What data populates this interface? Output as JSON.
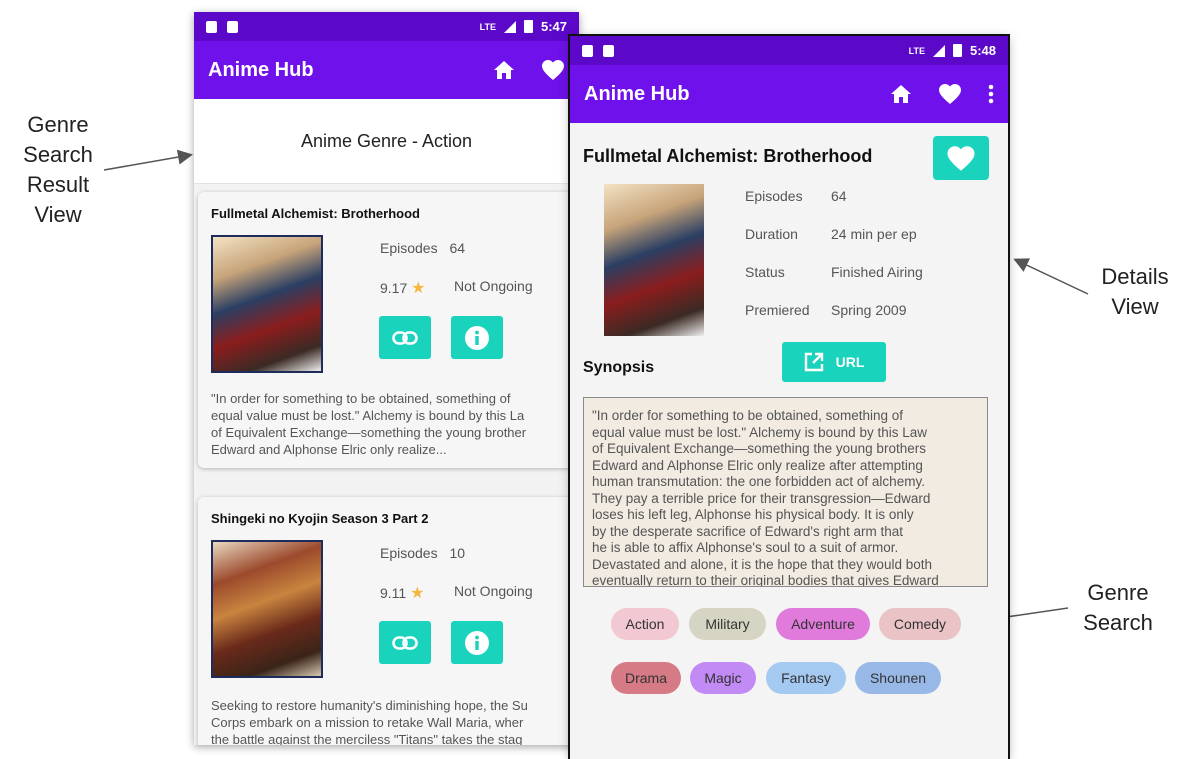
{
  "annotations": {
    "genre_result_lines": [
      "Genre",
      "Search",
      "Result",
      "View"
    ],
    "details_lines": [
      "Details",
      "View"
    ],
    "genre_search_lines": [
      "Genre",
      "Search"
    ]
  },
  "left_screen": {
    "status_time": "5:47",
    "status_network": "LTE",
    "app_title": "Anime Hub",
    "genre_heading": "Anime Genre - Action",
    "cards": [
      {
        "title": "Fullmetal Alchemist: Brotherhood",
        "episodes_label": "Episodes",
        "episodes": "64",
        "score": "9.17",
        "airing": "Not Ongoing",
        "synopsis_lines": [
          "\"In order for something to be obtained, something of",
          "equal value must be lost.\" Alchemy is bound by this La",
          "of Equivalent Exchange—something the young brother",
          "Edward and Alphonse Elric only realize..."
        ]
      },
      {
        "title": "Shingeki no Kyojin Season 3 Part 2",
        "episodes_label": "Episodes",
        "episodes": "10",
        "score": "9.11",
        "airing": "Not Ongoing",
        "synopsis_lines": [
          "Seeking to restore humanity's diminishing hope, the Su",
          "Corps embark on a mission to retake Wall Maria, wher",
          "the battle against the merciless \"Titans\" takes the stag"
        ]
      }
    ]
  },
  "right_screen": {
    "status_time": "5:48",
    "status_network": "LTE",
    "app_title": "Anime Hub",
    "title": "Fullmetal Alchemist: Brotherhood",
    "details": [
      {
        "label": "Episodes",
        "value": "64"
      },
      {
        "label": "Duration",
        "value": "24 min per ep"
      },
      {
        "label": "Status",
        "value": "Finished Airing"
      },
      {
        "label": "Premiered",
        "value": "Spring 2009"
      }
    ],
    "synopsis_label": "Synopsis",
    "url_label": "URL",
    "synopsis_lines": [
      "\"In order for something to be obtained, something of",
      "equal value must be lost.\" Alchemy is bound by this Law",
      "of Equivalent Exchange—something the young brothers",
      "Edward and Alphonse Elric only realize after attempting",
      "human transmutation: the one forbidden act of alchemy.",
      "They pay a terrible price for their transgression—Edward",
      "loses his left leg, Alphonse his physical body. It is only",
      "by the desperate sacrifice of Edward's right arm that",
      "he is able to affix Alphonse's soul to a suit of armor.",
      "Devastated and alone, it is the hope that they would both",
      "eventually return to their original bodies that gives Edward"
    ],
    "genres": [
      {
        "label": "Action",
        "color": "#f2c9d2"
      },
      {
        "label": "Military",
        "color": "#d6d5c3"
      },
      {
        "label": "Adventure",
        "color": "#e07bdc"
      },
      {
        "label": "Comedy",
        "color": "#e9c3c6"
      },
      {
        "label": "Drama",
        "color": "#d67a86"
      },
      {
        "label": "Magic",
        "color": "#c18af5"
      },
      {
        "label": "Fantasy",
        "color": "#a5caf2"
      },
      {
        "label": "Shounen",
        "color": "#98b9e8"
      }
    ]
  },
  "colors": {
    "status_bar": "#5b08c9",
    "app_bar": "#6e11ea",
    "accent": "#1ad3bd",
    "star": "#f5b642"
  }
}
